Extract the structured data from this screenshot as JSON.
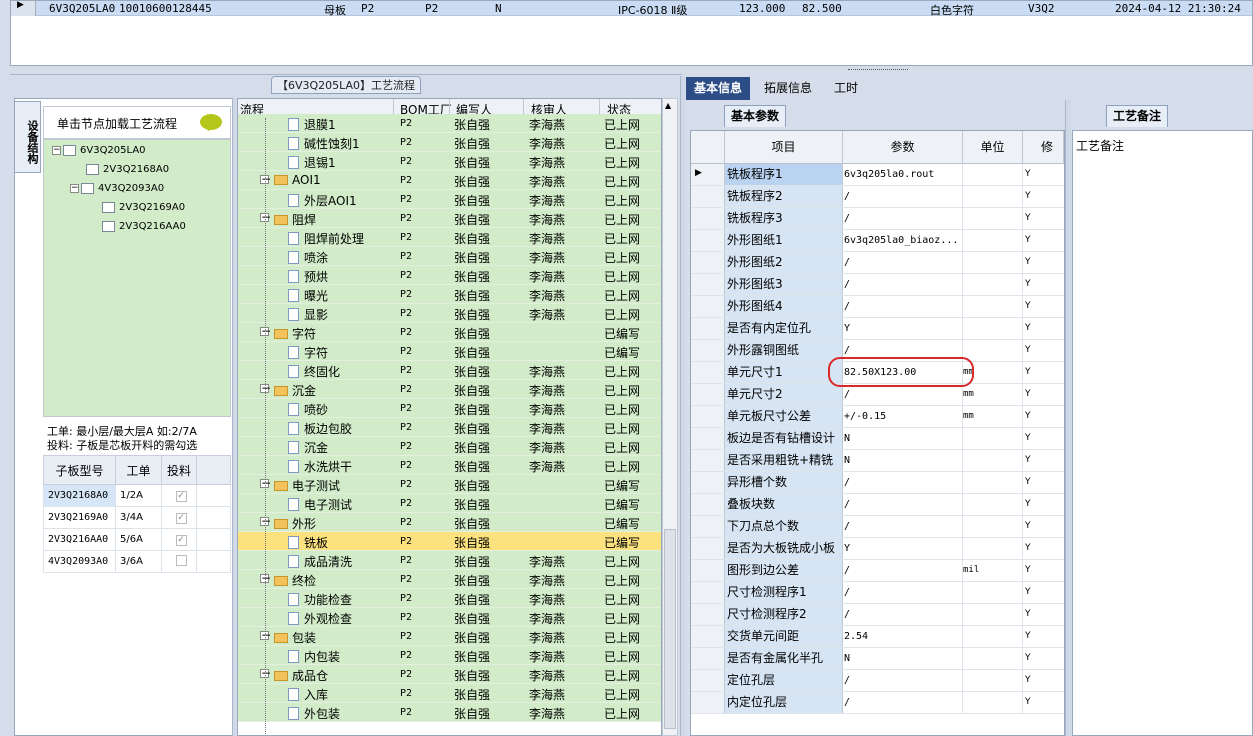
{
  "top_row": {
    "code": "6V3Q205LA0",
    "number": "10010600128445",
    "type": "母板",
    "f1": "P2",
    "f2": "P2",
    "f3": "N",
    "grade": "IPC-6018 Ⅱ级",
    "dim1": "123.000",
    "dim2": "82.500",
    "silk": "白色字符",
    "ver": "V3Q2",
    "time": "2024-04-12 21:30:24"
  },
  "left": {
    "vertical_tab": "设备结构",
    "panel_title": "【6V3Q205LA0】工艺流程",
    "load_hint": "单击节点加载工艺流程",
    "tree": [
      {
        "label": "6V3Q205LA0"
      },
      {
        "label": "2V3Q2168A0"
      },
      {
        "label": "4V3Q2093A0"
      },
      {
        "label": "2V3Q2169A0"
      },
      {
        "label": "2V3Q216AA0"
      }
    ],
    "note_line1": "工单: 最小层/最大层A 如:2/7A",
    "note_line2": "投料: 子板是芯板开料的需勾选",
    "sub_headers": [
      "子板型号",
      "工单",
      "投料"
    ],
    "sub_rows": [
      {
        "model": "2V3Q2168A0",
        "order": "1/2A",
        "checked": "✓"
      },
      {
        "model": "2V3Q2169A0",
        "order": "3/4A",
        "checked": "✓"
      },
      {
        "model": "2V3Q216AA0",
        "order": "5/6A",
        "checked": "✓"
      },
      {
        "model": "4V3Q2093A0",
        "order": "3/6A",
        "checked": ""
      }
    ]
  },
  "flow": {
    "headers": [
      "流程",
      "BOM工厂",
      "编写人",
      "核审人",
      "状态"
    ],
    "rows": [
      {
        "name": "退膜1",
        "bom": "P2",
        "writer": "张自强",
        "checker": "李海燕",
        "status": "已上网",
        "lvl": 2
      },
      {
        "name": "碱性蚀刻1",
        "bom": "P2",
        "writer": "张自强",
        "checker": "李海燕",
        "status": "已上网",
        "lvl": 2
      },
      {
        "name": "退锡1",
        "bom": "P2",
        "writer": "张自强",
        "checker": "李海燕",
        "status": "已上网",
        "lvl": 2
      },
      {
        "name": "AOI1",
        "bom": "P2",
        "writer": "张自强",
        "checker": "李海燕",
        "status": "已上网",
        "lvl": 1
      },
      {
        "name": "外层AOI1",
        "bom": "P2",
        "writer": "张自强",
        "checker": "李海燕",
        "status": "已上网",
        "lvl": 2
      },
      {
        "name": "阻焊",
        "bom": "P2",
        "writer": "张自强",
        "checker": "李海燕",
        "status": "已上网",
        "lvl": 1
      },
      {
        "name": "阻焊前处理",
        "bom": "P2",
        "writer": "张自强",
        "checker": "李海燕",
        "status": "已上网",
        "lvl": 2
      },
      {
        "name": "喷涂",
        "bom": "P2",
        "writer": "张自强",
        "checker": "李海燕",
        "status": "已上网",
        "lvl": 2
      },
      {
        "name": "预烘",
        "bom": "P2",
        "writer": "张自强",
        "checker": "李海燕",
        "status": "已上网",
        "lvl": 2
      },
      {
        "name": "曝光",
        "bom": "P2",
        "writer": "张自强",
        "checker": "李海燕",
        "status": "已上网",
        "lvl": 2
      },
      {
        "name": "显影",
        "bom": "P2",
        "writer": "张自强",
        "checker": "李海燕",
        "status": "已上网",
        "lvl": 2
      },
      {
        "name": "字符",
        "bom": "P2",
        "writer": "张自强",
        "checker": "",
        "status": "已编写",
        "lvl": 1
      },
      {
        "name": "字符",
        "bom": "P2",
        "writer": "张自强",
        "checker": "",
        "status": "已编写",
        "lvl": 2
      },
      {
        "name": "终固化",
        "bom": "P2",
        "writer": "张自强",
        "checker": "李海燕",
        "status": "已上网",
        "lvl": 2
      },
      {
        "name": "沉金",
        "bom": "P2",
        "writer": "张自强",
        "checker": "李海燕",
        "status": "已上网",
        "lvl": 1
      },
      {
        "name": "喷砂",
        "bom": "P2",
        "writer": "张自强",
        "checker": "李海燕",
        "status": "已上网",
        "lvl": 2
      },
      {
        "name": "板边包胶",
        "bom": "P2",
        "writer": "张自强",
        "checker": "李海燕",
        "status": "已上网",
        "lvl": 2
      },
      {
        "name": "沉金",
        "bom": "P2",
        "writer": "张自强",
        "checker": "李海燕",
        "status": "已上网",
        "lvl": 2
      },
      {
        "name": "水洗烘干",
        "bom": "P2",
        "writer": "张自强",
        "checker": "李海燕",
        "status": "已上网",
        "lvl": 2
      },
      {
        "name": "电子测试",
        "bom": "P2",
        "writer": "张自强",
        "checker": "",
        "status": "已编写",
        "lvl": 1
      },
      {
        "name": "电子测试",
        "bom": "P2",
        "writer": "张自强",
        "checker": "",
        "status": "已编写",
        "lvl": 2
      },
      {
        "name": "外形",
        "bom": "P2",
        "writer": "张自强",
        "checker": "",
        "status": "已编写",
        "lvl": 1
      },
      {
        "name": "铣板",
        "bom": "P2",
        "writer": "张自强",
        "checker": "",
        "status": "已编写",
        "lvl": 2,
        "hl": true
      },
      {
        "name": "成品清洗",
        "bom": "P2",
        "writer": "张自强",
        "checker": "李海燕",
        "status": "已上网",
        "lvl": 2
      },
      {
        "name": "终检",
        "bom": "P2",
        "writer": "张自强",
        "checker": "李海燕",
        "status": "已上网",
        "lvl": 1
      },
      {
        "name": "功能检查",
        "bom": "P2",
        "writer": "张自强",
        "checker": "李海燕",
        "status": "已上网",
        "lvl": 2
      },
      {
        "name": "外观检查",
        "bom": "P2",
        "writer": "张自强",
        "checker": "李海燕",
        "status": "已上网",
        "lvl": 2
      },
      {
        "name": "包装",
        "bom": "P2",
        "writer": "张自强",
        "checker": "李海燕",
        "status": "已上网",
        "lvl": 1
      },
      {
        "name": "内包装",
        "bom": "P2",
        "writer": "张自强",
        "checker": "李海燕",
        "status": "已上网",
        "lvl": 2
      },
      {
        "name": "成品仓",
        "bom": "P2",
        "writer": "张自强",
        "checker": "李海燕",
        "status": "已上网",
        "lvl": 1
      },
      {
        "name": "入库",
        "bom": "P2",
        "writer": "张自强",
        "checker": "李海燕",
        "status": "已上网",
        "lvl": 2
      },
      {
        "name": "外包装",
        "bom": "P2",
        "writer": "张自强",
        "checker": "李海燕",
        "status": "已上网",
        "lvl": 2
      }
    ]
  },
  "right": {
    "tabs": [
      "基本信息",
      "拓展信息",
      "工时"
    ],
    "subtab": "基本参数",
    "headers": [
      "项目",
      "参数",
      "单位",
      "修改"
    ],
    "rows": [
      {
        "k": "铣板程序1",
        "v": "6v3q205la0.rout",
        "u": "",
        "m": "Y"
      },
      {
        "k": "铣板程序2",
        "v": "/",
        "u": "",
        "m": "Y"
      },
      {
        "k": "铣板程序3",
        "v": "/",
        "u": "",
        "m": "Y"
      },
      {
        "k": "外形图纸1",
        "v": "6v3q205la0_biaoz...",
        "u": "",
        "m": "Y"
      },
      {
        "k": "外形图纸2",
        "v": "/",
        "u": "",
        "m": "Y"
      },
      {
        "k": "外形图纸3",
        "v": "/",
        "u": "",
        "m": "Y"
      },
      {
        "k": "外形图纸4",
        "v": "/",
        "u": "",
        "m": "Y"
      },
      {
        "k": "是否有内定位孔",
        "v": "Y",
        "u": "",
        "m": "Y"
      },
      {
        "k": "外形露铜图纸",
        "v": "/",
        "u": "",
        "m": "Y"
      },
      {
        "k": "单元尺寸1",
        "v": "82.50X123.00",
        "u": "mm",
        "m": "Y"
      },
      {
        "k": "单元尺寸2",
        "v": "/",
        "u": "mm",
        "m": "Y"
      },
      {
        "k": "单元板尺寸公差",
        "v": "+/-0.15",
        "u": "mm",
        "m": "Y"
      },
      {
        "k": "板边是否有钻槽设计",
        "v": "N",
        "u": "",
        "m": "Y"
      },
      {
        "k": "是否采用粗铣+精铣",
        "v": "N",
        "u": "",
        "m": "Y"
      },
      {
        "k": "异形槽个数",
        "v": "/",
        "u": "",
        "m": "Y"
      },
      {
        "k": "叠板块数",
        "v": "/",
        "u": "",
        "m": "Y"
      },
      {
        "k": "下刀点总个数",
        "v": "/",
        "u": "",
        "m": "Y"
      },
      {
        "k": "是否为大板铣成小板",
        "v": "Y",
        "u": "",
        "m": "Y"
      },
      {
        "k": "图形到边公差",
        "v": "/",
        "u": "mil",
        "m": "Y"
      },
      {
        "k": "尺寸检测程序1",
        "v": "/",
        "u": "",
        "m": "Y"
      },
      {
        "k": "尺寸检测程序2",
        "v": "/",
        "u": "",
        "m": "Y"
      },
      {
        "k": "交货单元间距",
        "v": "2.54",
        "u": "",
        "m": "Y"
      },
      {
        "k": "是否有金属化半孔",
        "v": "N",
        "u": "",
        "m": "Y"
      },
      {
        "k": "定位孔层",
        "v": "/",
        "u": "",
        "m": "Y"
      },
      {
        "k": "内定位孔层",
        "v": "/",
        "u": "",
        "m": "Y"
      }
    ],
    "note_tab": "工艺备注",
    "note_label": "工艺备注"
  }
}
